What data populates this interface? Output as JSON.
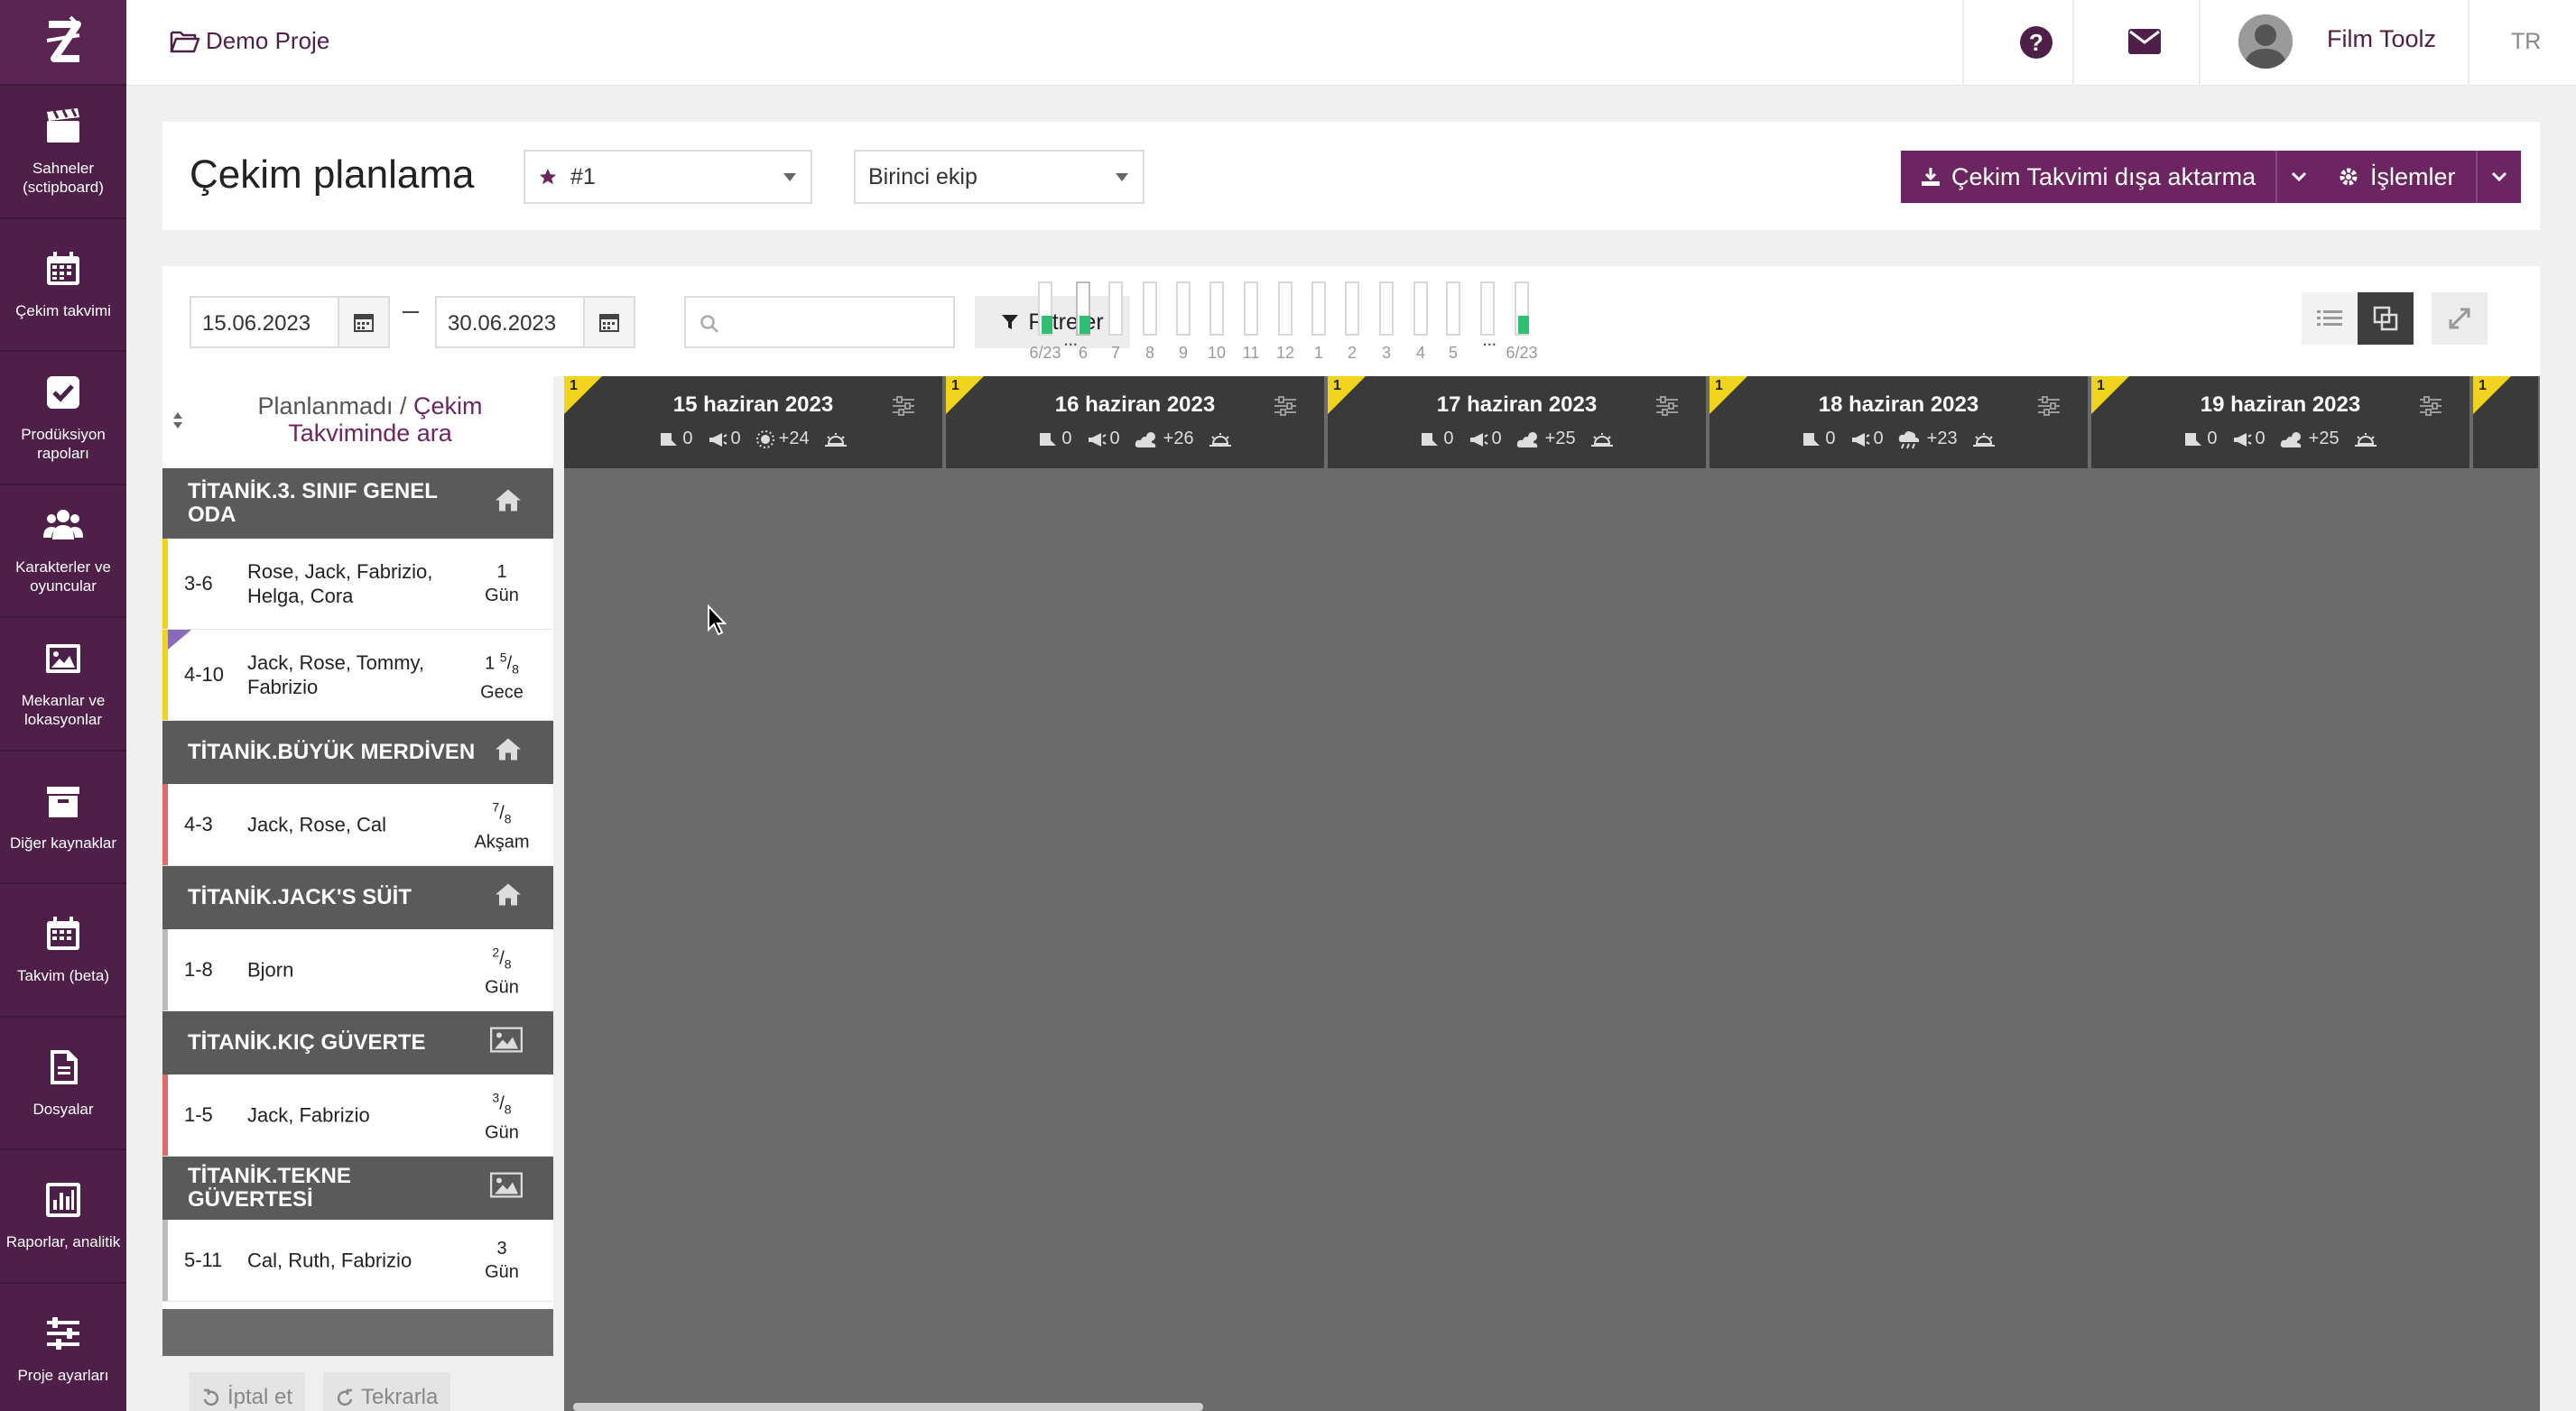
{
  "topbar": {
    "project": "Demo Proje",
    "user": "Film Toolz",
    "lang": "TR"
  },
  "sidebar": {
    "items": [
      {
        "label": "Sahneler (sctipboard)",
        "icon": "clapperboard-icon"
      },
      {
        "label": "Çekim takvimi",
        "icon": "calendar-icon"
      },
      {
        "label": "Prodüksiyon rapoları",
        "icon": "checkbox-icon"
      },
      {
        "label": "Karakterler ve oyuncular",
        "icon": "users-icon"
      },
      {
        "label": "Mekanlar ve lokasyonlar",
        "icon": "image-icon"
      },
      {
        "label": "Diğer kaynaklar",
        "icon": "archive-icon"
      },
      {
        "label": "Takvim (beta)",
        "icon": "calendar-grid-icon"
      },
      {
        "label": "Dosyalar",
        "icon": "file-icon"
      },
      {
        "label": "Raporlar, analitik",
        "icon": "chart-icon"
      },
      {
        "label": "Proje ayarları",
        "icon": "sliders-icon"
      }
    ]
  },
  "header": {
    "title": "Çekim planlama",
    "schedule_select": "#1",
    "team_select": "Birinci ekip",
    "export_btn": "Çekim Takvimi dışa aktarma",
    "actions_btn": "İşlemler"
  },
  "filters": {
    "from_date": "15.06.2023",
    "to_date": "30.06.2023",
    "filter_btn": "Filtreler",
    "timeline": {
      "left_label": "6/23",
      "right_label": "6/23",
      "days": [
        "6",
        "7",
        "8",
        "9",
        "10",
        "11",
        "12",
        "1",
        "2",
        "3",
        "4",
        "5"
      ],
      "fills": [
        0.35,
        0.35,
        0,
        0,
        0,
        0,
        0,
        0,
        0,
        0,
        0,
        0,
        0,
        0,
        0.35
      ]
    }
  },
  "left": {
    "header_plain": "Planlanmadı / ",
    "header_link": "Çekim Takviminde ara",
    "groups": [
      {
        "name": "TİTANİK.3. SINIF GENEL ODA",
        "icon": "home-icon",
        "scenes": [
          {
            "no": "3-6",
            "cast": "Rose, Jack, Fabrizio, Helga, Cora",
            "len_main": "1",
            "len_frac": "",
            "time": "Gün",
            "color": "#f0d31c"
          },
          {
            "no": "4-10",
            "cast": "Jack, Rose, Tommy, Fabrizio",
            "len_main": "1 ",
            "len_frac": "5/8",
            "time": "Gece",
            "color": "#f0d31c"
          }
        ]
      },
      {
        "name": "TİTANİK.BÜYÜK MERDİVEN",
        "icon": "home-icon",
        "scenes": [
          {
            "no": "4-3",
            "cast": "Jack, Rose, Cal",
            "len_main": "",
            "len_frac": "7/8",
            "time": "Akşam",
            "color": "#e06a6a"
          }
        ]
      },
      {
        "name": "TİTANİK.JACK'S SÜİT",
        "icon": "home-icon",
        "scenes": [
          {
            "no": "1-8",
            "cast": "Bjorn",
            "len_main": "",
            "len_frac": "2/8",
            "time": "Gün",
            "color": "#bbbbbb"
          }
        ]
      },
      {
        "name": "TİTANİK.KIÇ GÜVERTE",
        "icon": "image-icon",
        "scenes": [
          {
            "no": "1-5",
            "cast": "Jack, Fabrizio",
            "len_main": "",
            "len_frac": "3/8",
            "time": "Gün",
            "color": "#e06a6a"
          }
        ]
      },
      {
        "name": "TİTANİK.TEKNE GÜVERTESİ",
        "icon": "image-icon",
        "scenes": [
          {
            "no": "5-11",
            "cast": "Cal, Ruth, Fabrizio",
            "len_main": "3",
            "len_frac": "",
            "time": "Gün",
            "color": "#bbbbbb"
          }
        ]
      }
    ],
    "cancel_btn": "İptal et",
    "redo_btn": "Tekrarla"
  },
  "calendar": {
    "days": [
      {
        "num": "1",
        "date": "15 haziran 2023",
        "a": "0",
        "b": "0",
        "temp": "+24",
        "weather": "sun-icon"
      },
      {
        "num": "1",
        "date": "16 haziran 2023",
        "a": "0",
        "b": "0",
        "temp": "+26",
        "weather": "cloud-sun-icon"
      },
      {
        "num": "1",
        "date": "17 haziran 2023",
        "a": "0",
        "b": "0",
        "temp": "+25",
        "weather": "cloud-sun-icon"
      },
      {
        "num": "1",
        "date": "18 haziran 2023",
        "a": "0",
        "b": "0",
        "temp": "+23",
        "weather": "cloud-rain-icon"
      },
      {
        "num": "1",
        "date": "19 haziran 2023",
        "a": "0",
        "b": "0",
        "temp": "+25",
        "weather": "cloud-sun-icon"
      },
      {
        "num": "1",
        "date": "",
        "a": "",
        "b": "",
        "temp": "",
        "weather": ""
      }
    ]
  },
  "colors": {
    "brand": "#4e1f48",
    "button": "#6d2561",
    "dayheader": "#3a3a3a",
    "calbg": "#6b6b6b",
    "progress": "#2fbf71"
  }
}
